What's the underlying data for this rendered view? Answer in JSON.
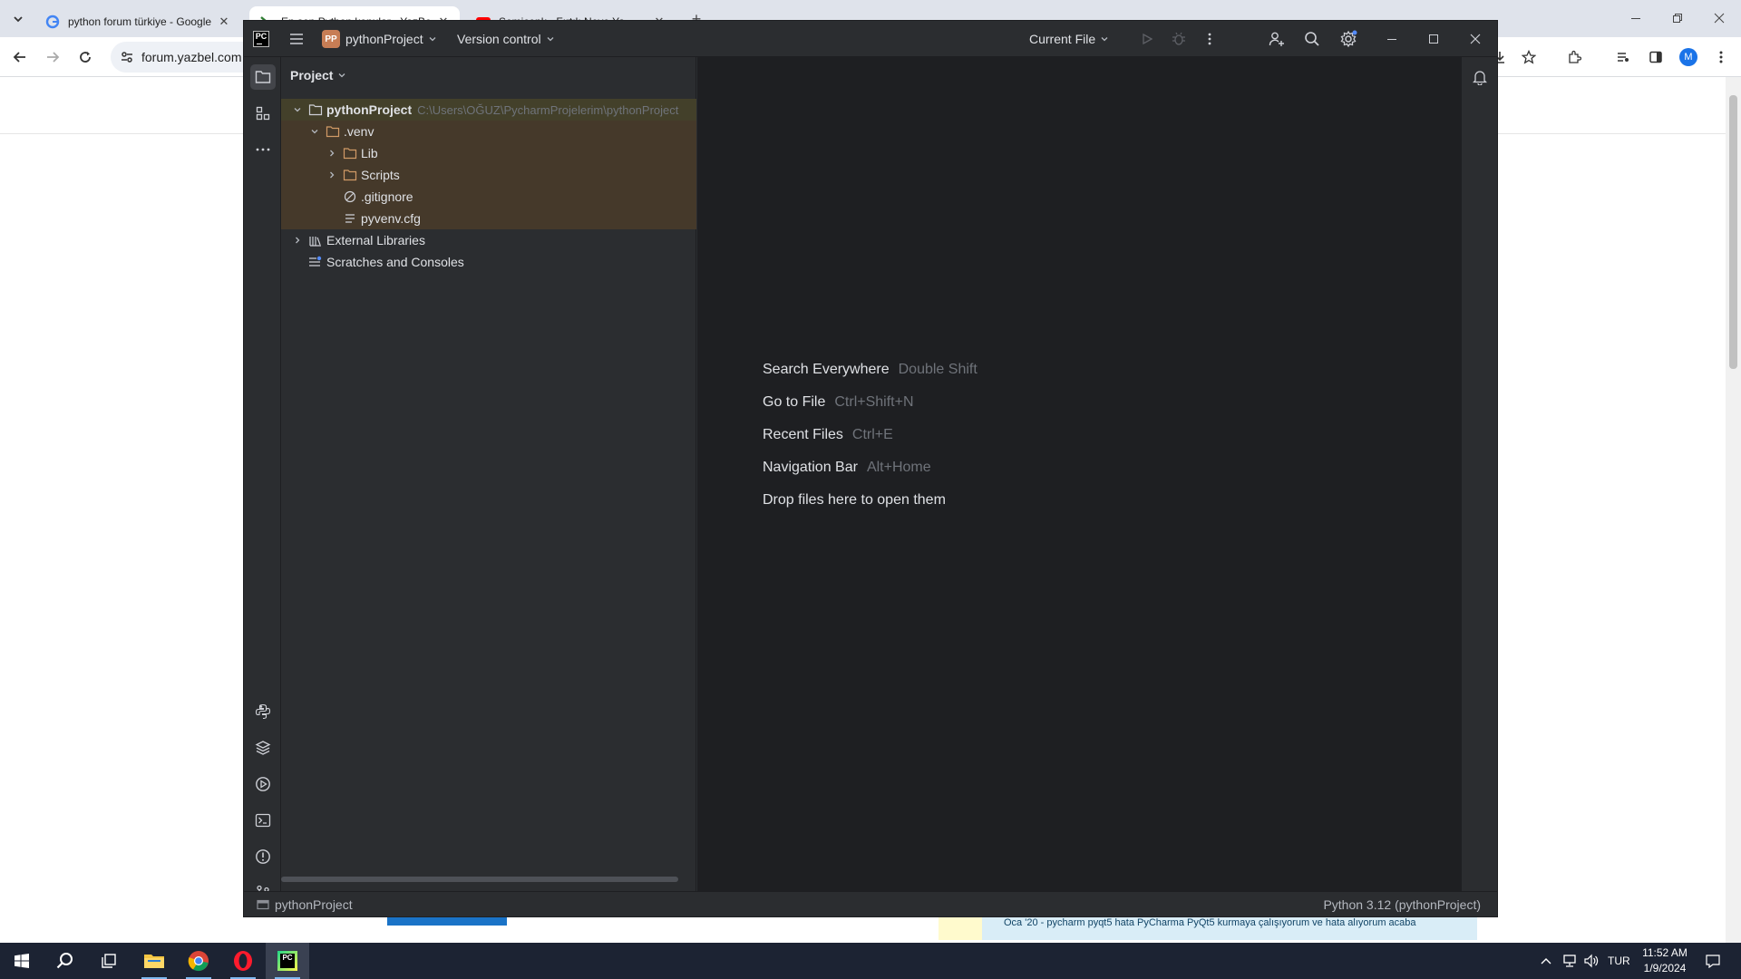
{
  "browser": {
    "tabs": [
      {
        "title": "python forum türkiye - Google",
        "active": false
      },
      {
        "title": "En son Python konular - YazBel",
        "active": true
      },
      {
        "title": "Semicenk - Fırtılı Neye Ya...",
        "active": false
      }
    ],
    "new_tab": "+",
    "address": "forum.yazbel.com",
    "profile_initial": "M",
    "notification_text": "Oca '20 - pycharm pyqt5 hata PyCharma PyQt5 kurmaya çalışıyorum ve hata alıyorum acaba"
  },
  "pycharm": {
    "logo": "PC",
    "project_badge": "PP",
    "project_name": "pythonProject",
    "vcs_label": "Version control",
    "run_config": "Current File",
    "panel_title": "Project",
    "tree": [
      {
        "label": "pythonProject",
        "path": "C:\\Users\\OĞUZ\\PycharmProjelerim\\pythonProject"
      },
      {
        "label": ".venv"
      },
      {
        "label": "Lib"
      },
      {
        "label": "Scripts"
      },
      {
        "label": ".gitignore"
      },
      {
        "label": "pyvenv.cfg"
      },
      {
        "label": "External Libraries"
      },
      {
        "label": "Scratches and Consoles"
      }
    ],
    "hints": [
      {
        "label": "Search Everywhere",
        "key": "Double Shift"
      },
      {
        "label": "Go to File",
        "key": "Ctrl+Shift+N"
      },
      {
        "label": "Recent Files",
        "key": "Ctrl+E"
      },
      {
        "label": "Navigation Bar",
        "key": "Alt+Home"
      },
      {
        "label": "Drop files here to open them",
        "key": ""
      }
    ],
    "status_left": "pythonProject",
    "status_right": "Python 3.12 (pythonProject)"
  },
  "taskbar": {
    "language": "TUR",
    "time": "11:52 AM",
    "date": "1/9/2024"
  }
}
